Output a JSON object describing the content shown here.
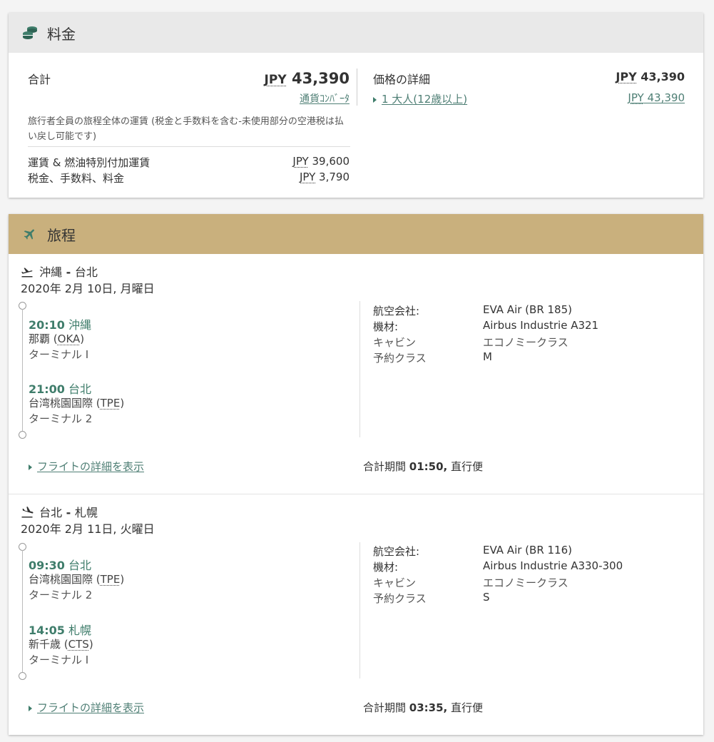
{
  "fare": {
    "title": "料金",
    "icon": "coins-icon",
    "total_label": "合計",
    "total_currency": "JPY",
    "total_amount": "43,390",
    "currency_converter": "通貨ｺﾝﾊﾞｰﾀ",
    "note": "旅行者全員の旅程全体の運賃 (税金と手数料を含む-未使用部分の空港税は払い戻し可能です)",
    "breakdown": [
      {
        "label": "運賃 & 燃油特別付加運賃",
        "currency": "JPY",
        "amount": "39,600"
      },
      {
        "label": "税金、手数料、料金",
        "currency": "JPY",
        "amount": "3,790"
      }
    ],
    "details_label": "価格の詳細",
    "details_currency": "JPY",
    "details_amount": "43,390",
    "passenger_link": "1 大人(12歳以上)",
    "passenger_currency": "JPY",
    "passenger_amount": "43,390"
  },
  "itinerary": {
    "title": "旅程",
    "icon": "airplane-icon",
    "header_color": "#c9b07d",
    "flights": [
      {
        "route_from": "沖縄",
        "route_sep": " - ",
        "route_to": "台北",
        "date": "2020年 2月 10日, 月曜日",
        "dep_time": "20:10",
        "dep_city": "沖縄",
        "dep_airport": "那覇",
        "dep_code": "OKA",
        "dep_terminal": "ターミナル I",
        "arr_time": "21:00",
        "arr_city": "台北",
        "arr_airport": "台湾桃園国際",
        "arr_code": "TPE",
        "arr_terminal": "ターミナル 2",
        "airline_label": "航空会社:",
        "airline": "EVA Air (BR 185)",
        "aircraft_label": "機材:",
        "aircraft": "Airbus Industrie A321",
        "cabin_label": "キャビン",
        "cabin": "エコノミークラス",
        "class_label": "予約クラス",
        "booking_class": "M",
        "details_link": "フライトの詳細を表示",
        "duration_label": "合計期間",
        "duration": "01:50,",
        "nonstop": "直行便"
      },
      {
        "route_from": "台北",
        "route_sep": " - ",
        "route_to": "札幌",
        "date": "2020年 2月 11日, 火曜日",
        "dep_time": "09:30",
        "dep_city": "台北",
        "dep_airport": "台湾桃園国際",
        "dep_code": "TPE",
        "dep_terminal": "ターミナル 2",
        "arr_time": "14:05",
        "arr_city": "札幌",
        "arr_airport": "新千歳",
        "arr_code": "CTS",
        "arr_terminal": "ターミナル I",
        "airline_label": "航空会社:",
        "airline": "EVA Air (BR 116)",
        "aircraft_label": "機材:",
        "aircraft": "Airbus Industrie A330-300",
        "cabin_label": "キャビン",
        "cabin": "エコノミークラス",
        "class_label": "予約クラス",
        "booking_class": "S",
        "details_link": "フライトの詳細を表示",
        "duration_label": "合計期間",
        "duration": "03:35,",
        "nonstop": "直行便"
      }
    ]
  }
}
